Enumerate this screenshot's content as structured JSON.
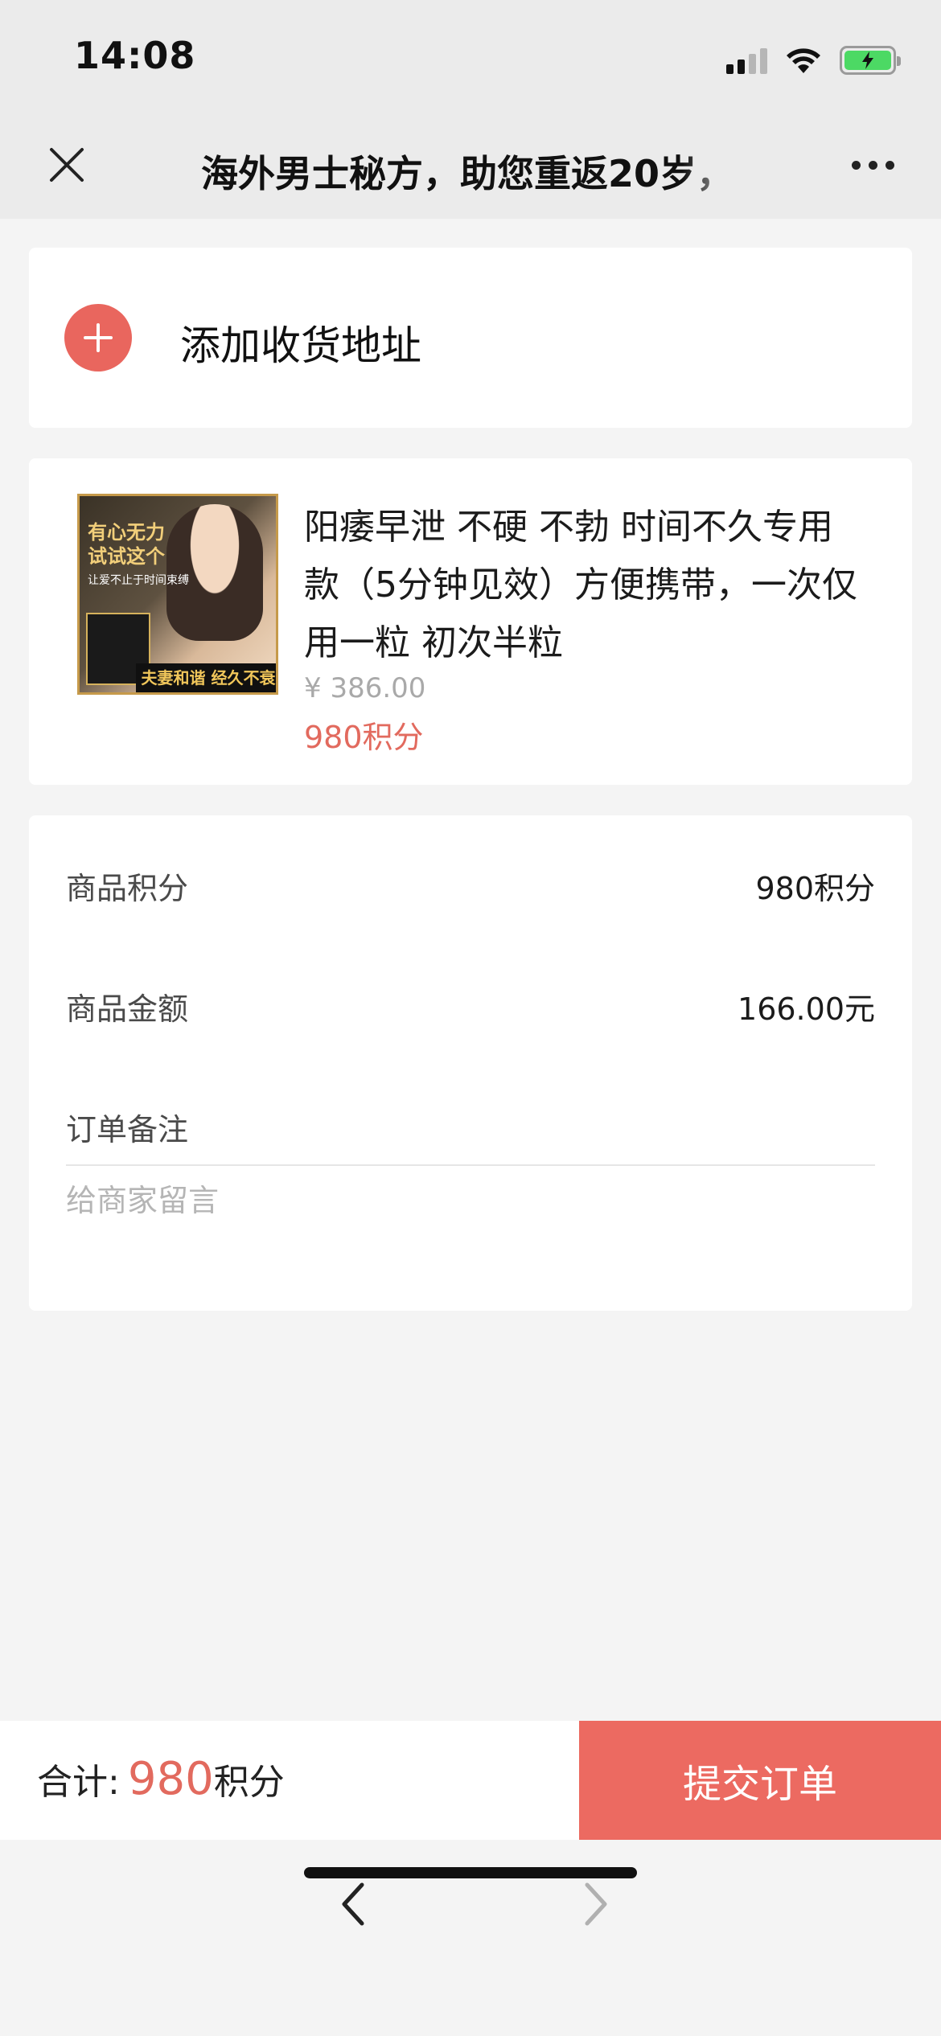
{
  "status_bar": {
    "time": "14:08"
  },
  "navbar": {
    "title": "海外男士秘方，助您重返20岁，"
  },
  "address": {
    "add_label": "添加收货地址"
  },
  "product": {
    "image_text": {
      "line1": "有心无力",
      "line2": "试试这个",
      "small": "让爱不止于时间束缚",
      "banner": "夫妻和谐 经久不衰"
    },
    "title": "阳痿早泄 不硬 不勃 时间不久专用款（5分钟见效）方便携带，一次仅用一粒 初次半粒",
    "price": "¥ 386.00",
    "points": "980积分"
  },
  "summary": {
    "points_label": "商品积分",
    "points_value": "980积分",
    "amount_label": "商品金额",
    "amount_value": "166.00元",
    "remark_label": "订单备注",
    "remark_placeholder": "给商家留言"
  },
  "bottom_bar": {
    "total_label": "合计:",
    "total_value": "980",
    "total_unit": "积分",
    "submit_label": "提交订单"
  },
  "colors": {
    "accent": "#ec6a61",
    "points_text": "#e26a5e",
    "battery_green": "#4cd964"
  },
  "icons": {
    "close": "close-icon",
    "more": "more-icon",
    "add": "plus-icon",
    "back": "chevron-left-icon",
    "forward": "chevron-right-icon"
  }
}
